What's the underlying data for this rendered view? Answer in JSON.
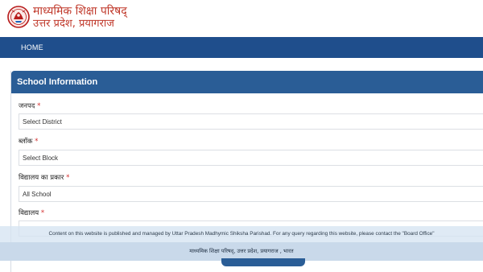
{
  "header": {
    "org_name_line1": "माध्यमिक शिक्षा परिषद्",
    "org_name_line2": "उत्तर प्रदेश, प्रयागराज"
  },
  "nav": {
    "home_label": "HOME"
  },
  "form": {
    "title": "School Information",
    "required_mark": "*",
    "fields": [
      {
        "label": "जनपद",
        "selected": "Select District"
      },
      {
        "label": "ब्लॉक",
        "selected": "Select Block"
      },
      {
        "label": "विद्यालय का प्रकार",
        "selected": "All School"
      },
      {
        "label": "विद्यालय",
        "selected": ""
      }
    ]
  },
  "footer": {
    "notice": "Content on this website is published and managed by Uttar Pradesh Madhymic Shiksha Parishad. For any query regarding this website, please contact the \"Board Office\"",
    "bottom_text": "माध्यमिक शिक्षा परिषद्, उत्तर प्रदेश, प्रयागराज , भारत"
  },
  "colors": {
    "brand_red": "#c0392b",
    "nav_blue": "#1f4e8c",
    "card_header_blue": "#2a5d96",
    "required_red": "#d32f2f"
  },
  "icons": {
    "logo": "up-emblem-icon"
  }
}
